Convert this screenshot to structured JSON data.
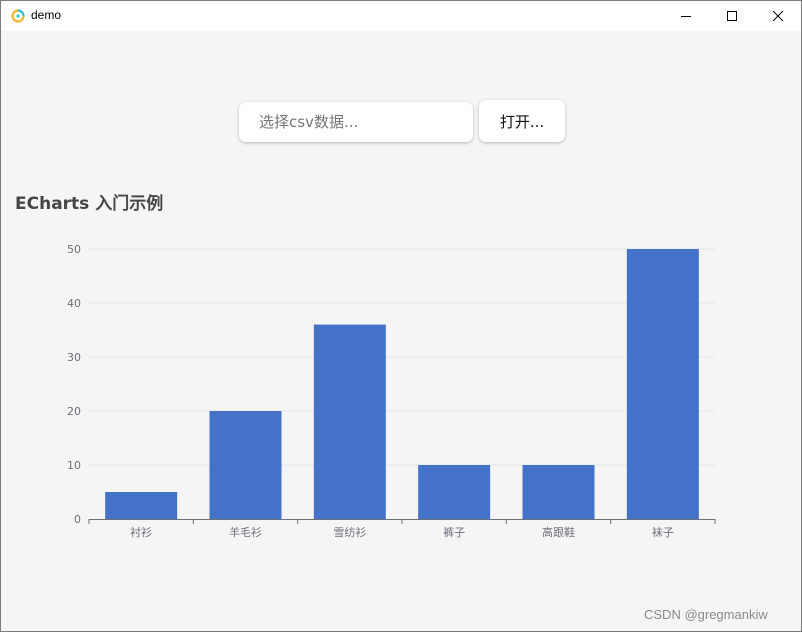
{
  "window": {
    "title": "demo",
    "icons": {
      "app": "app-logo-icon",
      "minimize": "minimize-icon",
      "maximize": "maximize-icon",
      "close": "close-icon"
    }
  },
  "toolbar": {
    "csv_input_value": "",
    "csv_input_placeholder": "选择csv数据...",
    "open_label": "打开..."
  },
  "chart_data": {
    "type": "bar",
    "title": "ECharts 入门示例",
    "categories": [
      "衬衫",
      "羊毛衫",
      "雪纺衫",
      "裤子",
      "高跟鞋",
      "袜子"
    ],
    "values": [
      5,
      20,
      36,
      10,
      10,
      50
    ],
    "ylim": [
      0,
      50
    ],
    "yticks": [
      0,
      10,
      20,
      30,
      40,
      50
    ],
    "grid": true,
    "legend": "none",
    "bar_color": "#4472c8"
  },
  "watermark": "CSDN @gregmankiw"
}
